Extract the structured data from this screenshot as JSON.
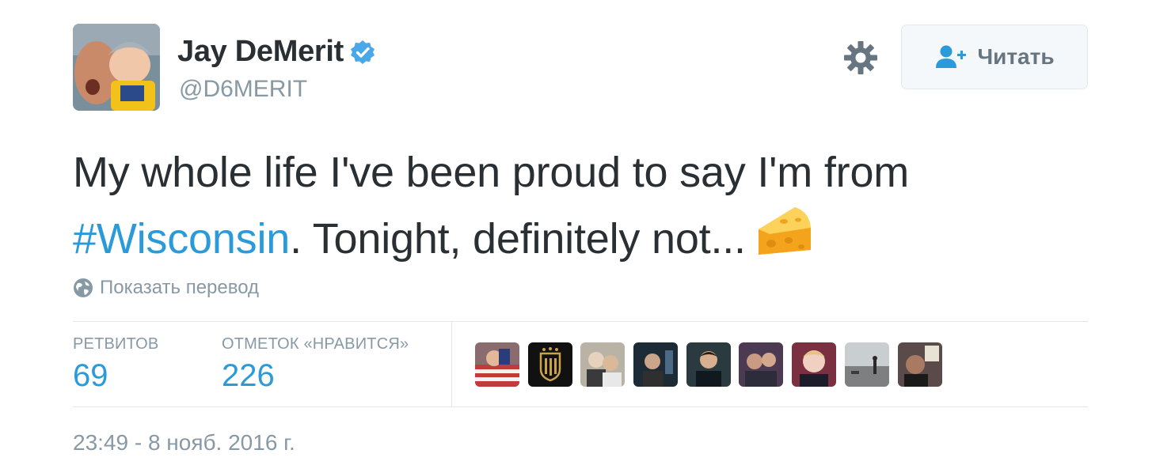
{
  "tweet": {
    "author": {
      "display_name": "Jay DeMerit",
      "handle": "@D6MERIT",
      "verified": true,
      "avatar_icon": "avatar-photo"
    },
    "follow_button": {
      "label": "Читать",
      "icon": "add-user-icon"
    },
    "settings_icon": "gear-icon",
    "text": {
      "line1": "My whole life I've been proud to say I'm from",
      "hashtag": "#Wisconsin",
      "line2_rest": ". Tonight, definitely not...",
      "emoji": "cheese-wedge"
    },
    "translate_link": {
      "label": "Показать перевод",
      "icon": "globe-icon"
    },
    "stats": {
      "retweets": {
        "label": "РЕТВИТОВ",
        "value": "69"
      },
      "likes": {
        "label": "ОТМЕТОК «НРАВИТСЯ»",
        "value": "226"
      }
    },
    "likers_count_shown": 9,
    "timestamp": "23:49 - 8 нояб. 2016 г."
  },
  "colors": {
    "link": "#2b9ad9",
    "muted": "#8899a6",
    "text": "#292f33",
    "border": "#e1e8ed",
    "verified": "#4aa7e8",
    "cheese": "#f7b32b"
  }
}
